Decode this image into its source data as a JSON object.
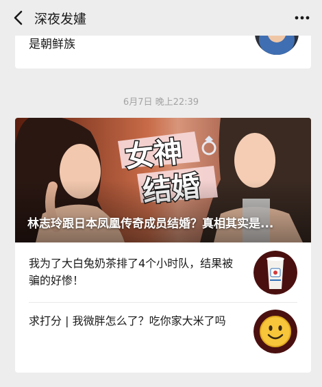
{
  "header": {
    "title": "深夜发嫿",
    "back_icon": "chevron-left-icon",
    "more_icon": "more-dots-icon"
  },
  "previous_card": {
    "text": "是朝鲜族"
  },
  "timestamp": "6月7日 晚上22:39",
  "main_article": {
    "cover_overlay_text": "女神结婚",
    "headline": "林志玲跟日本凤凰传奇成员结婚？真相其实是..."
  },
  "sub_articles": [
    {
      "title": "我为了大白兔奶茶排了4个小时队，结果被骗的好惨！",
      "thumb_icon": "milk-tea-cup-icon"
    },
    {
      "title": "求打分 | 我微胖怎么了？吃你家大米了吗",
      "thumb_icon": "smiley-emoji-icon"
    }
  ],
  "colors": {
    "background": "#ededed",
    "card": "#ffffff",
    "timestamp": "#a3a3a3",
    "cover_title_fill": "#ffffff",
    "cover_title_stroke": "#1a1a1a",
    "thumb_bg_dark": "#4a1010"
  }
}
